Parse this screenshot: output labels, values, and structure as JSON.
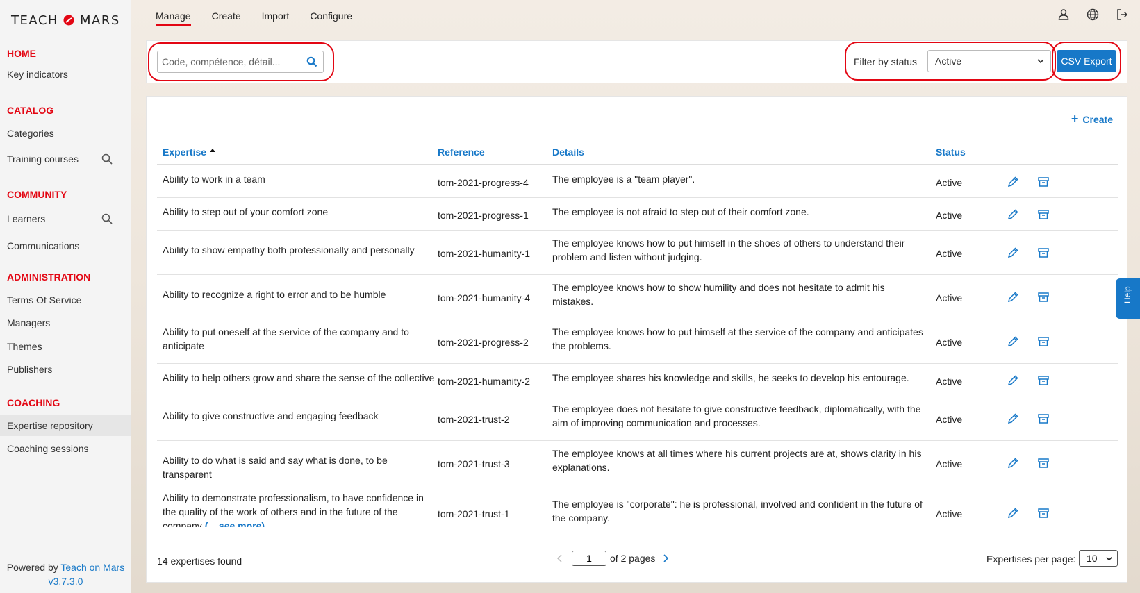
{
  "brand": {
    "prefix": "TEACH",
    "on": "ON",
    "suffix": "MARS"
  },
  "sidebar": {
    "sections": [
      {
        "title": "HOME",
        "items": [
          {
            "label": "Key indicators"
          }
        ]
      },
      {
        "title": "CATALOG",
        "items": [
          {
            "label": "Categories"
          },
          {
            "label": "Training courses"
          }
        ]
      },
      {
        "title": "COMMUNITY",
        "items": [
          {
            "label": "Learners"
          },
          {
            "label": "Communications"
          }
        ]
      },
      {
        "title": "ADMINISTRATION",
        "items": [
          {
            "label": "Terms Of Service"
          },
          {
            "label": "Managers"
          },
          {
            "label": "Themes"
          },
          {
            "label": "Publishers"
          }
        ]
      },
      {
        "title": "COACHING",
        "items": [
          {
            "label": "Expertise repository"
          },
          {
            "label": "Coaching sessions"
          }
        ]
      }
    ],
    "powered_by": "Powered by",
    "powered_link": "Teach on Mars",
    "version": "v3.7.3.0"
  },
  "topnav": {
    "tabs": [
      "Manage",
      "Create",
      "Import",
      "Configure"
    ]
  },
  "toolbar": {
    "search_placeholder": "Code, compétence, détail...",
    "filter_label": "Filter by status",
    "status_value": "Active",
    "csv_export": "CSV Export"
  },
  "table": {
    "create_label": "Create",
    "headers": {
      "expertise": "Expertise",
      "reference": "Reference",
      "details": "Details",
      "status": "Status"
    },
    "rows": [
      {
        "expertise": "Ability to work in a team",
        "reference": "tom-2021-progress-4",
        "details": "The employee is a \"team player\".",
        "status": "Active"
      },
      {
        "expertise": "Ability to step out of your comfort zone",
        "reference": "tom-2021-progress-1",
        "details": "The employee is not afraid to step out of their comfort zone.",
        "status": "Active"
      },
      {
        "expertise": "Ability to show empathy both professionally and personally",
        "reference": "tom-2021-humanity-1",
        "details": "The employee knows how to put himself in the shoes of others to understand their problem and listen without judging.",
        "status": "Active"
      },
      {
        "expertise": "Ability to recognize a right to error and to be humble",
        "reference": "tom-2021-humanity-4",
        "details": "The employee knows how to show humility and does not hesitate to admit his mistakes.",
        "status": "Active"
      },
      {
        "expertise": "Ability to put oneself at the service of the company and to anticipate",
        "reference": "tom-2021-progress-2",
        "details": "The employee knows how to put himself at the service of the company and anticipates the problems.",
        "status": "Active"
      },
      {
        "expertise": "Ability to help others grow and share the sense of the collective",
        "reference": "tom-2021-humanity-2",
        "details": "The employee shares his knowledge and skills, he seeks to develop his entourage.",
        "status": "Active"
      },
      {
        "expertise": "Ability to give constructive and engaging feedback",
        "reference": "tom-2021-trust-2",
        "details": "The employee does not hesitate to give constructive feedback, diplomatically, with the aim of improving communication and processes.",
        "status": "Active"
      },
      {
        "expertise": "Ability to do what is said and say what is done, to be transparent",
        "reference": "tom-2021-trust-3",
        "details": "The employee knows at all times where his current projects are at, shows clarity in his explanations.",
        "status": "Active"
      },
      {
        "expertise": "Ability to demonstrate professionalism, to have confidence in the quality of the work of others and in the future of the company",
        "reference": "tom-2021-trust-1",
        "details": "The employee is \"corporate\": he is professional, involved and confident in the future of the company.",
        "status": "Active",
        "see_more": "(... see more)"
      }
    ]
  },
  "footer": {
    "count_text": "14 expertises found",
    "page_value": "1",
    "of_pages": "of 2 pages",
    "per_page_label": "Expertises per page:",
    "per_page_value": "10"
  },
  "help_tab": "Help",
  "colors": {
    "accent": "#1778c8",
    "brand_red": "#e30613"
  }
}
